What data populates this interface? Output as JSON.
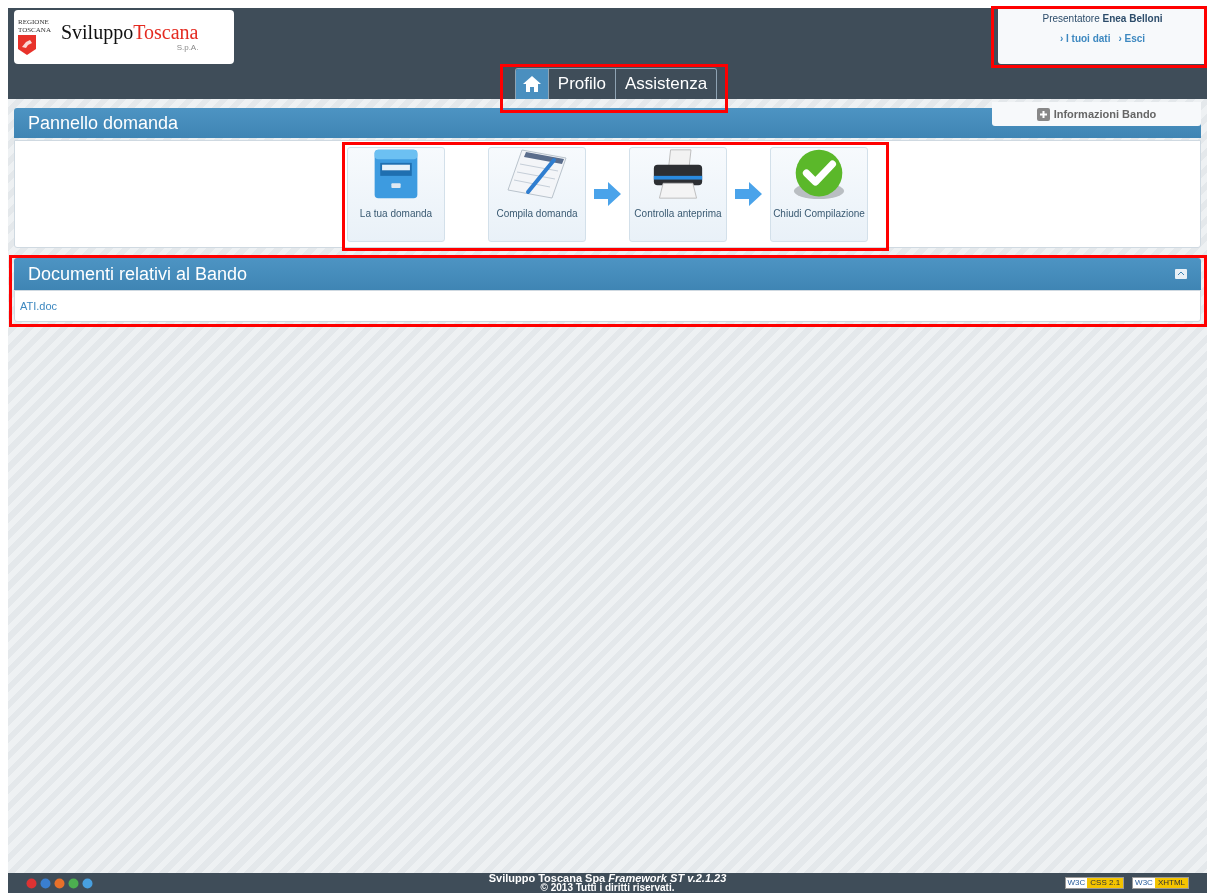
{
  "logo": {
    "region": [
      "REGIONE",
      "TOSCANA"
    ],
    "name_a": "Sviluppo",
    "name_b": "Toscana",
    "suffix": "S.p.A."
  },
  "nav": [
    {
      "kind": "home",
      "selected": true
    },
    {
      "kind": "text",
      "label": "Profilo",
      "selected": false
    },
    {
      "kind": "text",
      "label": "Assistenza",
      "selected": false
    }
  ],
  "user": {
    "role": "Presentatore",
    "name": "Enea Belloni",
    "links": [
      "› I tuoi dati",
      "› Esci"
    ]
  },
  "info_tab": "Informazioni Bando",
  "panel": {
    "title": "Pannello domanda",
    "steps": [
      {
        "kind": "cabinet",
        "label": "La tua domanda",
        "arrow_before": false
      },
      {
        "kind": "form",
        "label": "Compila domanda",
        "arrow_before": false
      },
      {
        "kind": "printer",
        "label": "Controlla anteprima",
        "arrow_before": true
      },
      {
        "kind": "check",
        "label": "Chiudi Compilazione",
        "arrow_before": true
      }
    ]
  },
  "documents": {
    "title": "Documenti relativi al Bando",
    "files": [
      "ATI.doc"
    ]
  },
  "footer": {
    "line1": "Sviluppo Toscana Spa *Framework ST v.2.1.23*",
    "line2": "© 2013 Tutti i diritti riservati.",
    "badges": [
      {
        "org": "W3C",
        "label": "CSS 2.1"
      },
      {
        "org": "W3C",
        "label": "XHTML"
      }
    ]
  }
}
